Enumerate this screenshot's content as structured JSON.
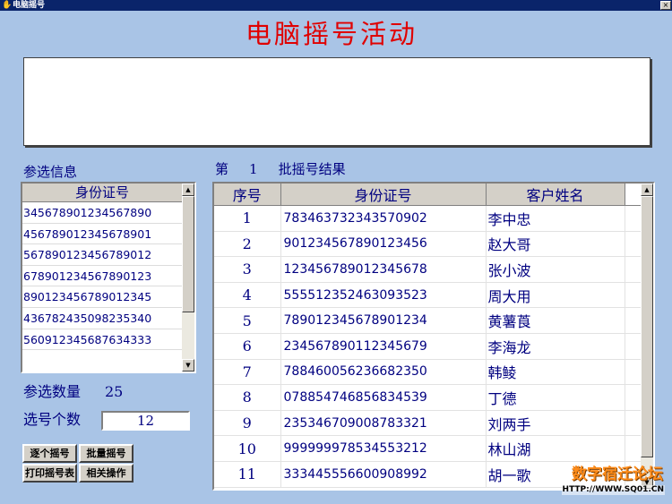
{
  "window": {
    "title": "电脑摇号",
    "app_icon": "hand-icon",
    "close_symbol": "×"
  },
  "heading": "电脑摇号活动",
  "participants": {
    "section_label": "参选信息",
    "column_header": "身份证号",
    "ids": [
      "345678901234567890",
      "456789012345678901",
      "567890123456789012",
      "678901234567890123",
      "890123456789012345",
      "436782435098235340",
      "560912345687634333"
    ]
  },
  "batch": {
    "prefix": "第",
    "number": "1",
    "suffix": "批摇号结果"
  },
  "results": {
    "headers": {
      "seq": "序号",
      "id": "身份证号",
      "name": "客户姓名"
    },
    "rows": [
      {
        "seq": "1",
        "id": "783463732343570902",
        "name": "李中忠"
      },
      {
        "seq": "2",
        "id": "901234567890123456",
        "name": "赵大哥"
      },
      {
        "seq": "3",
        "id": "123456789012345678",
        "name": "张小波"
      },
      {
        "seq": "4",
        "id": "555512352463093523",
        "name": "周大用"
      },
      {
        "seq": "5",
        "id": "789012345678901234",
        "name": "黄薯莨"
      },
      {
        "seq": "6",
        "id": "234567890112345679",
        "name": "李海龙"
      },
      {
        "seq": "7",
        "id": "788460056236682350",
        "name": "韩鲮"
      },
      {
        "seq": "8",
        "id": "078854746856834539",
        "name": "丁德"
      },
      {
        "seq": "9",
        "id": "235346709008783321",
        "name": "刘两手"
      },
      {
        "seq": "10",
        "id": "999999978534553212",
        "name": "林山湖"
      },
      {
        "seq": "11",
        "id": "333445556600908992",
        "name": "胡一歌"
      }
    ]
  },
  "count": {
    "label": "参选数量",
    "value": "25"
  },
  "pick": {
    "label": "选号个数",
    "value": "12"
  },
  "buttons": {
    "single_draw": "逐个摇号",
    "batch_draw": "批量摇号",
    "print_table": "打印摇号表",
    "related_ops": "相关操作"
  },
  "watermark": {
    "text": "数字宿迁论坛",
    "url": "HTTP://WWW.SQ01.CN"
  },
  "colors": {
    "background": "#a9c4e6",
    "heading": "#e00000",
    "text": "#000080",
    "titlebar": "#0a246a",
    "button_face": "#d4d0c8",
    "watermark": "#ff8c1a"
  }
}
